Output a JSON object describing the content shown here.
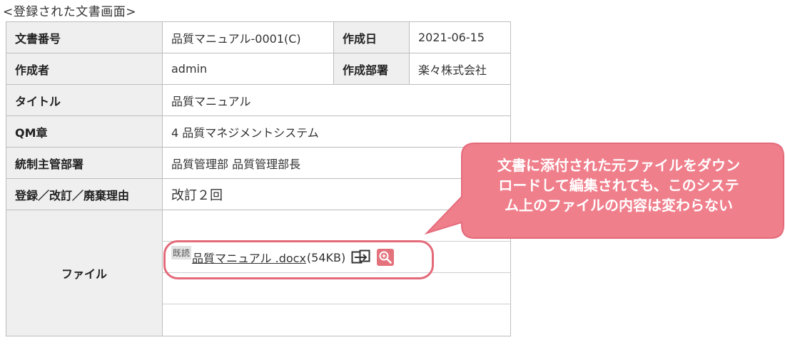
{
  "caption": "<登録された文書画面>",
  "fields": {
    "doc_number_label": "文書番号",
    "doc_number": "品質マニュアル-0001(C)",
    "created_date_label": "作成日",
    "created_date": "2021-06-15",
    "author_label": "作成者",
    "author": "admin",
    "dept_label": "作成部署",
    "dept": "楽々株式会社",
    "title_label": "タイトル",
    "title": "品質マニュアル",
    "qm_label": "QM章",
    "qm": "4 品質マネジメントシステム",
    "control_dept_label": "統制主管部署",
    "control_dept": "品質管理部 品質管理部長",
    "reason_label": "登録／改訂／廃棄理由",
    "reason": "改訂２回",
    "file_label": "ファイル"
  },
  "file": {
    "read_badge": "既読",
    "name": "品質マニュアル .docx",
    "size": "(54KB)",
    "icons": [
      "compare-icon",
      "preview-zoom-icon"
    ]
  },
  "callout": {
    "lines": [
      "文書に添付された元ファイルをダウン",
      "ロードして編集されても、このシステ",
      "ム上のファイルの内容は変わらない"
    ],
    "fill_color": "#f07f8c",
    "border_color": "#e46a7a"
  }
}
